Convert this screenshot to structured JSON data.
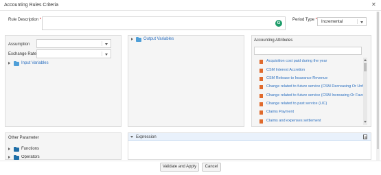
{
  "dialog": {
    "title": "Accounting Rules Criteria"
  },
  "form": {
    "rule_description_label": "Rule Description",
    "required_mark": "*",
    "rule_description_value": "",
    "badge_letter": "G",
    "period_type_label": "Period Type",
    "period_type_value": "Incremental",
    "assumption_label": "Assumption",
    "assumption_value": "",
    "exchange_rate_label": "Exchange Rate",
    "exchange_rate_value": ""
  },
  "tree": {
    "input_variables": "Input Variables",
    "output_variables": "Output Variables",
    "other_parameter_label": "Other Parameter",
    "functions": "Functions",
    "operators": "Operators"
  },
  "attributes": {
    "title": "Accounting Attributes",
    "search_value": "",
    "items": [
      "Acquisition cost paid during the year",
      "CSM Interest Accretion",
      "CSM Release to Insurance Revenue",
      "Change related to future service (CSM Decreasing Or Unfa",
      "Change related to future service (CSM Increasing Or Favo",
      "Change related to past service (LIC)",
      "Claims Payment",
      "Claims and expenses settlement"
    ]
  },
  "expression": {
    "title": "Expression",
    "value": ""
  },
  "footer": {
    "validate_label": "Validate and Apply",
    "cancel_label": "Cancel"
  },
  "colors": {
    "link": "#2a6fc0",
    "doc_icon": "#e06a2c",
    "folder": "#4f9fd8",
    "badge": "#1f9d6b"
  },
  "icons": [
    "close-icon",
    "grammarly-icon",
    "chevron-down-icon",
    "folder-icon",
    "document-icon",
    "notes-icon"
  ]
}
